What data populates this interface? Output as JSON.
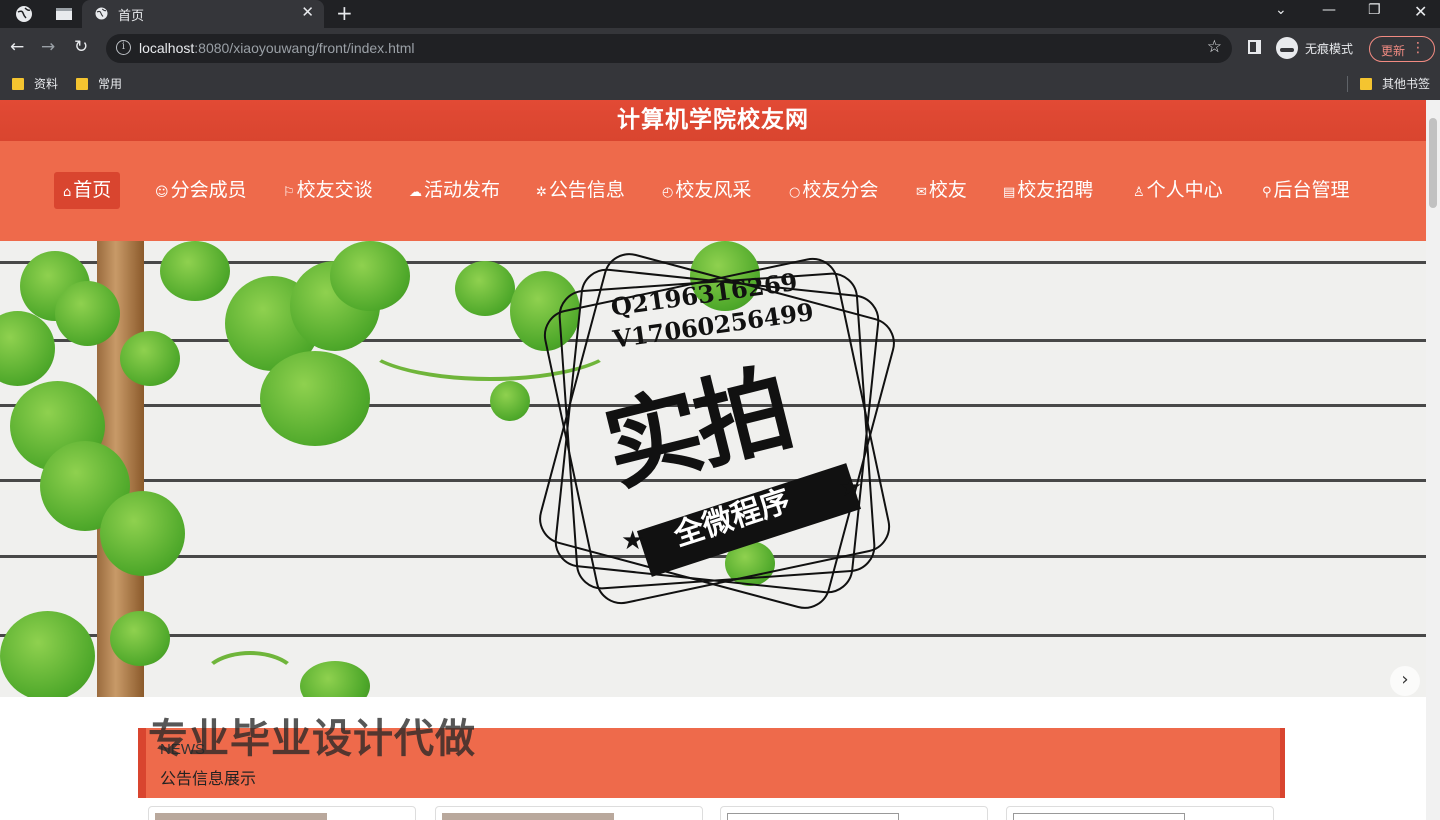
{
  "browser": {
    "tab_title": "首页",
    "url_host": "localhost",
    "url_rest": ":8080/xiaoyouwang/front/index.html",
    "incognito_label": "无痕模式",
    "update_label": "更新",
    "bookmarks": [
      "资料",
      "常用"
    ],
    "other_bookmarks": "其他书签"
  },
  "site": {
    "title": "计算机学院校友网",
    "nav": [
      {
        "icon": "⌂",
        "label": "首页"
      },
      {
        "icon": "☺",
        "label": "分会成员"
      },
      {
        "icon": "⚐",
        "label": "校友交谈"
      },
      {
        "icon": "☁",
        "label": "活动发布"
      },
      {
        "icon": "✲",
        "label": "公告信息"
      },
      {
        "icon": "◴",
        "label": "校友风采"
      },
      {
        "icon": "○",
        "label": "校友分会"
      },
      {
        "icon": "✉",
        "label": "校友"
      },
      {
        "icon": "▤",
        "label": "校友招聘"
      },
      {
        "icon": "♙",
        "label": "个人中心"
      },
      {
        "icon": "⚲",
        "label": "后台管理"
      }
    ]
  },
  "banner": {
    "stamp_qq": "Q2196316269",
    "stamp_vx": "V17060256499",
    "stamp_big": "实拍",
    "stamp_ribbon": "全微程序",
    "slides_total": 3,
    "slide_active": 1
  },
  "news": {
    "label_en": "NEWS",
    "label_cn": "公告信息展示"
  },
  "watermark": "专业毕业设计代做",
  "colors": {
    "brand": "#ee6a4b",
    "brand_dark": "#d9452f"
  }
}
